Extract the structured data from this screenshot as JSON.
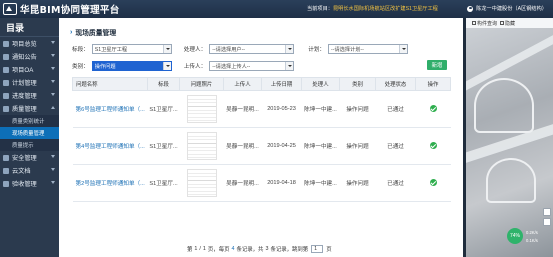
{
  "header": {
    "app_title": "华昆BIM协同管理平台",
    "project_label": "当前项目：",
    "project_name": "昆明长水国际机场航站区改扩建S1卫星厅工程",
    "user_text": "陈龙一中建股份（A区钢结构）"
  },
  "sidebar": {
    "title": "目录",
    "items": [
      {
        "label": "项目总览"
      },
      {
        "label": "通知公告"
      },
      {
        "label": "项目OA"
      },
      {
        "label": "计划管理"
      },
      {
        "label": "进度管理"
      },
      {
        "label": "质量管理"
      }
    ],
    "sub_items": [
      {
        "label": "质量类别统计"
      },
      {
        "label": "现场质量管理"
      },
      {
        "label": "质量提示"
      }
    ],
    "items_after": [
      {
        "label": "安全管理"
      },
      {
        "label": "云文档"
      },
      {
        "label": "验收管理"
      }
    ]
  },
  "main": {
    "section_title": "现场质量管理",
    "filters": {
      "section_label": "标段：",
      "section_value": "S1卫星厅工程",
      "handler_label": "处理人：",
      "handler_value": "--请选择用户--",
      "plan_label": "计划：",
      "plan_value": "--请选择计划--",
      "category_label": "类别：",
      "category_value": "操作问题",
      "uploader_label": "上传人：",
      "uploader_value": "--请选择上传人--"
    },
    "add_button": "新增",
    "table": {
      "headers": [
        "问题名称",
        "标段",
        "问题照片",
        "上传人",
        "上传日期",
        "处理人",
        "类别",
        "处理状态",
        "操作"
      ],
      "rows": [
        {
          "name": "第6号监理工程师通知单（...",
          "section": "S1卫星厅...",
          "uploader": "吴靜一昆明...",
          "date": "2019-05-23",
          "handler": "陈坤一中建...",
          "category": "操作问题",
          "status": "已通过"
        },
        {
          "name": "第4号监理工程师通知单（...",
          "section": "S1卫星厅...",
          "uploader": "吴靜一昆明...",
          "date": "2019-04-25",
          "handler": "陈坤一中建...",
          "category": "操作问题",
          "status": "已通过"
        },
        {
          "name": "第2号监理工程师通知单（...",
          "section": "S1卫星厅...",
          "uploader": "吴靜一昆明...",
          "date": "2019-04-18",
          "handler": "陈坤一中建...",
          "category": "操作问题",
          "status": "已通过"
        }
      ]
    },
    "pager": {
      "prefix": "第",
      "current": "1",
      "slash": "/",
      "total_pages": "1",
      "mid": "页，每页",
      "per_page": "4",
      "mid2": "条记录，共",
      "total": "3",
      "mid3": "条记录，跳到第",
      "jump": "1",
      "suffix": "页"
    }
  },
  "map": {
    "tool1": "构件查询",
    "tool2": "隐藏",
    "gauge_value": "74%",
    "speed1": "0.2K/s",
    "speed2": "0.1K/s"
  }
}
